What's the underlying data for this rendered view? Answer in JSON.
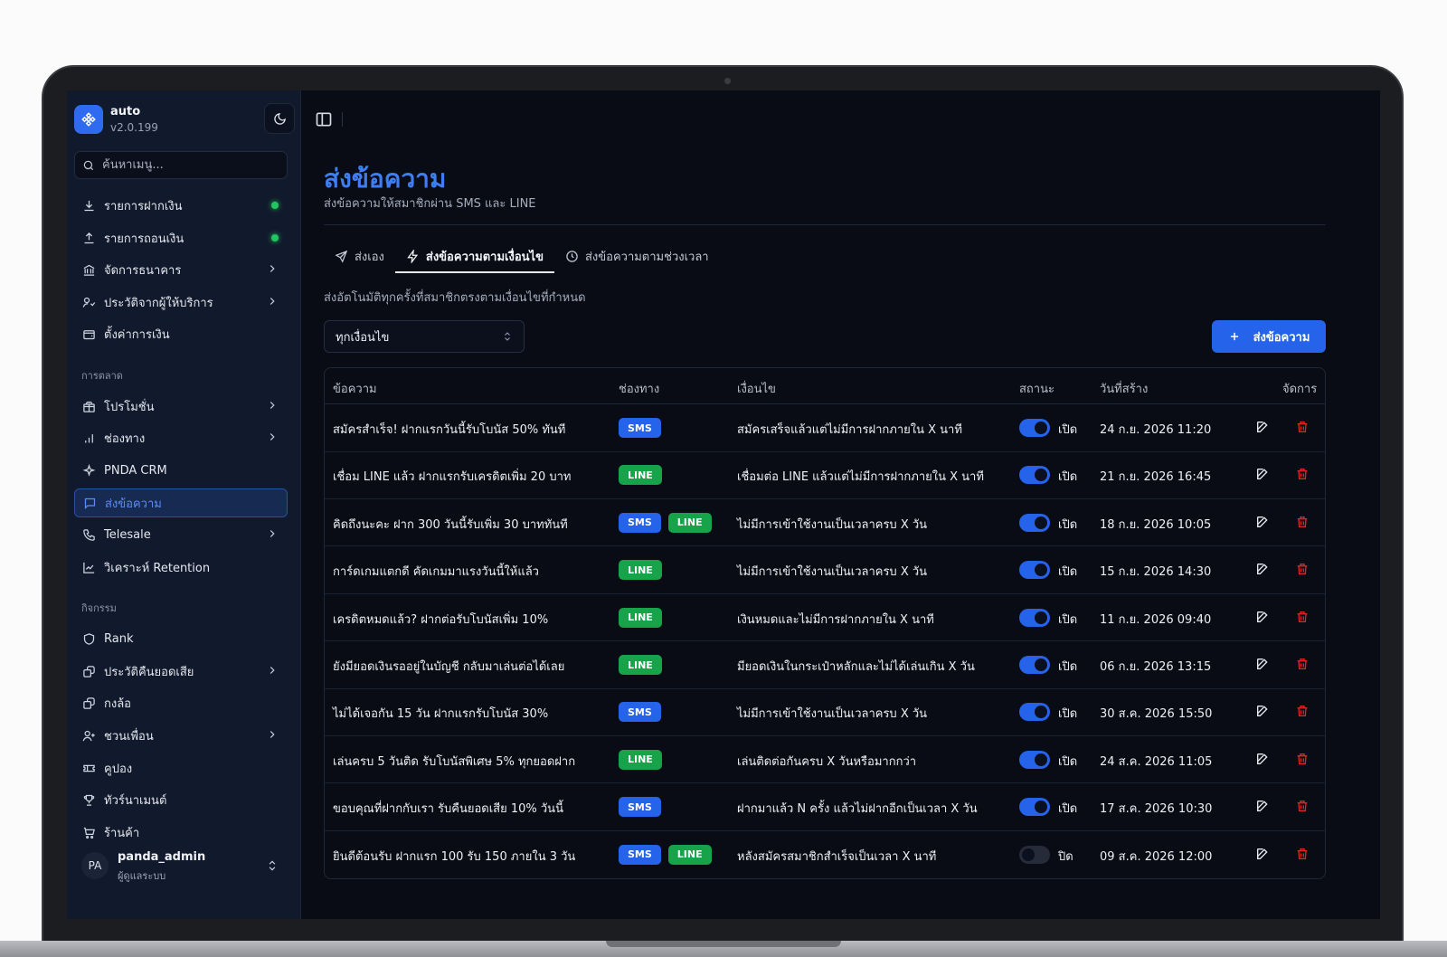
{
  "app": {
    "name": "auto",
    "version": "v2.0.199"
  },
  "search": {
    "placeholder": "ค้นหาเมนู..."
  },
  "sidebar": {
    "items_top": [
      {
        "label": "รายการฝากเงิน",
        "icon": "download-icon"
      },
      {
        "label": "รายการถอนเงิน",
        "icon": "upload-icon"
      },
      {
        "label": "จัดการธนาคาร",
        "icon": "bank-icon"
      },
      {
        "label": "ประวัติจากผู้ให้บริการ",
        "icon": "provider-history-icon"
      },
      {
        "label": "ตั้งค่าการเงิน",
        "icon": "wallet-settings-icon"
      }
    ],
    "section_marketing": "การตลาด",
    "items_marketing": [
      {
        "label": "โปรโมชั่น",
        "icon": "gift-icon"
      },
      {
        "label": "ช่องทาง",
        "icon": "bar-chart-icon"
      },
      {
        "label": "PNDA CRM",
        "icon": "sparkle-icon"
      },
      {
        "label": "ส่งข้อความ",
        "icon": "message-icon"
      },
      {
        "label": "Telesale",
        "icon": "phone-icon"
      },
      {
        "label": "วิเคราะห์ Retention",
        "icon": "line-chart-icon"
      }
    ],
    "section_activity": "กิจกรรม",
    "items_activity": [
      {
        "label": "Rank",
        "icon": "shield-icon"
      },
      {
        "label": "ประวัติคืนยอดเสีย",
        "icon": "refund-icon"
      },
      {
        "label": "กงล้อ",
        "icon": "wheel-icon"
      },
      {
        "label": "ชวนเพื่อน",
        "icon": "user-plus-icon"
      },
      {
        "label": "คูปอง",
        "icon": "ticket-icon"
      },
      {
        "label": "ทัวร์นาเมนต์",
        "icon": "trophy-icon"
      },
      {
        "label": "ร้านค้า",
        "icon": "cart-icon"
      }
    ],
    "user": {
      "initials": "PA",
      "name": "panda_admin",
      "role": "ผู้ดูแลระบบ"
    }
  },
  "page": {
    "title": "ส่งข้อความ",
    "subtitle": "ส่งข้อความให้สมาชิกผ่าน SMS และ LINE",
    "tabs": [
      {
        "label": "ส่งเอง",
        "icon": "send-icon"
      },
      {
        "label": "ส่งข้อความตามเงื่อนไข",
        "icon": "zap-icon"
      },
      {
        "label": "ส่งข้อความตามช่วงเวลา",
        "icon": "clock-icon"
      }
    ],
    "active_tab": "ส่งข้อความตามเงื่อนไข",
    "tab_description": "ส่งอัตโนมัติทุกครั้งที่สมาชิกตรงตามเงื่อนไขที่กำหนด",
    "filter_value": "ทุกเงื่อนไข",
    "create_button": "ส่งข้อความ"
  },
  "table": {
    "headers": {
      "message": "ข้อความ",
      "channel": "ช่องทาง",
      "condition": "เงื่อนไข",
      "status": "สถานะ",
      "created": "วันที่สร้าง",
      "actions": "จัดการ"
    },
    "rows": [
      {
        "message": "สมัครสำเร็จ! ฝากแรกวันนี้รับโบนัส 50% ทันที",
        "channels": [
          "SMS"
        ],
        "condition": "สมัครเสร็จแล้วแต่ไม่มีการฝากภายใน X นาที",
        "enabled": true,
        "status": "เปิด",
        "created": "24 ก.ย. 2026 11:20"
      },
      {
        "message": "เชื่อม LINE แล้ว ฝากแรกรับเครดิตเพิ่ม 20 บาท",
        "channels": [
          "LINE"
        ],
        "condition": "เชื่อมต่อ LINE แล้วแต่ไม่มีการฝากภายใน X นาที",
        "enabled": true,
        "status": "เปิด",
        "created": "21 ก.ย. 2026 16:45"
      },
      {
        "message": "คิดถึงนะคะ ฝาก 300 วันนี้รับเพิ่ม 30 บาททันที",
        "channels": [
          "SMS",
          "LINE"
        ],
        "condition": "ไม่มีการเข้าใช้งานเป็นเวลาครบ X วัน",
        "enabled": true,
        "status": "เปิด",
        "created": "18 ก.ย. 2026 10:05"
      },
      {
        "message": "การ์ดเกมแตกดี คัดเกมมาแรงวันนี้ให้แล้ว",
        "channels": [
          "LINE"
        ],
        "condition": "ไม่มีการเข้าใช้งานเป็นเวลาครบ X วัน",
        "enabled": true,
        "status": "เปิด",
        "created": "15 ก.ย. 2026 14:30"
      },
      {
        "message": "เครดิตหมดแล้ว? ฝากต่อรับโบนัสเพิ่ม 10%",
        "channels": [
          "LINE"
        ],
        "condition": "เงินหมดและไม่มีการฝากภายใน X นาที",
        "enabled": true,
        "status": "เปิด",
        "created": "11 ก.ย. 2026 09:40"
      },
      {
        "message": "ยังมียอดเงินรออยู่ในบัญชี กลับมาเล่นต่อได้เลย",
        "channels": [
          "LINE"
        ],
        "condition": "มียอดเงินในกระเป๋าหลักและไม่ได้เล่นเกิน X วัน",
        "enabled": true,
        "status": "เปิด",
        "created": "06 ก.ย. 2026 13:15"
      },
      {
        "message": "ไม่ได้เจอกัน 15 วัน ฝากแรกรับโบนัส 30%",
        "channels": [
          "SMS"
        ],
        "condition": "ไม่มีการเข้าใช้งานเป็นเวลาครบ X วัน",
        "enabled": true,
        "status": "เปิด",
        "created": "30 ส.ค. 2026 15:50"
      },
      {
        "message": "เล่นครบ 5 วันติด รับโบนัสพิเศษ 5% ทุกยอดฝาก",
        "channels": [
          "LINE"
        ],
        "condition": "เล่นติดต่อกันครบ X วันหรือมากกว่า",
        "enabled": true,
        "status": "เปิด",
        "created": "24 ส.ค. 2026 11:05"
      },
      {
        "message": "ขอบคุณที่ฝากกับเรา รับคืนยอดเสีย 10% วันนี้",
        "channels": [
          "SMS"
        ],
        "condition": "ฝากมาแล้ว N ครั้ง แล้วไม่ฝากอีกเป็นเวลา X วัน",
        "enabled": true,
        "status": "เปิด",
        "created": "17 ส.ค. 2026 10:30"
      },
      {
        "message": "ยินดีต้อนรับ ฝากแรก 100 รับ 150 ภายใน 3 วัน",
        "channels": [
          "SMS",
          "LINE"
        ],
        "condition": "หลังสมัครสมาชิกสำเร็จเป็นเวลา X นาที",
        "enabled": false,
        "status": "ปิด",
        "created": "09 ส.ค. 2026 12:00"
      }
    ]
  },
  "colors": {
    "accent": "#2563eb",
    "title": "#3f7df2",
    "sms_badge": "#2563eb",
    "line_badge": "#16a34a",
    "delete": "#dc2626",
    "online_dot": "#22c55e"
  }
}
